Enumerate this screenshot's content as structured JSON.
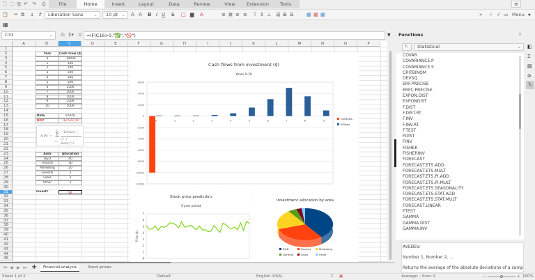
{
  "menu_tabs": [
    "File",
    "Home",
    "Insert",
    "Layout",
    "Data",
    "Review",
    "View",
    "Extension",
    "Tools"
  ],
  "active_tab": "Home",
  "toolbar": {
    "font_name": "Liberation Sans",
    "font_size": "10 pt",
    "menu_label": "Menu"
  },
  "formula_bar": {
    "cell_ref": "C31",
    "formula": "=IF(C16>0,\"✅\",\"🚫\")"
  },
  "columns": [
    "A",
    "B",
    "C",
    "D",
    "E",
    "F",
    "G",
    "H",
    "I",
    "J",
    "K",
    "L",
    "M",
    "N",
    "O",
    "P"
  ],
  "selected_column": "C",
  "selected_row": 31,
  "row_count": 45,
  "cells": [
    {
      "c": 1,
      "r": 2,
      "t": "Year",
      "b": true
    },
    {
      "c": 2,
      "r": 2,
      "t": "Cash Flow ($)",
      "b": true
    },
    {
      "c": 1,
      "r": 3,
      "t": "0"
    },
    {
      "c": 2,
      "r": 3,
      "t": "-10000"
    },
    {
      "c": 1,
      "r": 4,
      "t": "1"
    },
    {
      "c": 2,
      "r": 4,
      "t": "100"
    },
    {
      "c": 1,
      "r": 5,
      "t": "2"
    },
    {
      "c": 2,
      "r": 5,
      "t": "100"
    },
    {
      "c": 1,
      "r": 6,
      "t": "3"
    },
    {
      "c": 2,
      "r": 6,
      "t": "100"
    },
    {
      "c": 1,
      "r": 7,
      "t": "4"
    },
    {
      "c": 2,
      "r": 7,
      "t": "200"
    },
    {
      "c": 1,
      "r": 8,
      "t": "5"
    },
    {
      "c": 2,
      "r": 8,
      "t": "500"
    },
    {
      "c": 1,
      "r": 9,
      "t": "6"
    },
    {
      "c": 2,
      "r": 9,
      "t": "1500"
    },
    {
      "c": 1,
      "r": 10,
      "t": "7"
    },
    {
      "c": 2,
      "r": 10,
      "t": "3000"
    },
    {
      "c": 1,
      "r": 11,
      "t": "8"
    },
    {
      "c": 2,
      "r": 11,
      "t": "5000"
    },
    {
      "c": 1,
      "r": 12,
      "t": "9"
    },
    {
      "c": 2,
      "r": 12,
      "t": "3500"
    },
    {
      "c": 1,
      "r": 13,
      "t": "10"
    },
    {
      "c": 2,
      "r": 13,
      "t": "1000"
    },
    {
      "c": 1,
      "r": 15,
      "t": "Rate",
      "b": true,
      "l": true
    },
    {
      "c": 2,
      "r": 15,
      "t": "8.00%"
    },
    {
      "c": 1,
      "r": 16,
      "t": "NPV",
      "b": true,
      "l": true,
      "red": true
    },
    {
      "c": 2,
      "r": 16,
      "t": "-$1,522.09",
      "red": true
    },
    {
      "c": 1,
      "r": 23,
      "t": "Area",
      "b": true
    },
    {
      "c": 2,
      "r": 23,
      "t": "Allocation",
      "b": true
    },
    {
      "c": 1,
      "r": 24,
      "t": "R&D"
    },
    {
      "c": 2,
      "r": 24,
      "t": "40"
    },
    {
      "c": 1,
      "r": 25,
      "t": "Finance"
    },
    {
      "c": 2,
      "r": 25,
      "t": "30"
    },
    {
      "c": 1,
      "r": 26,
      "t": "Marketing"
    },
    {
      "c": 2,
      "r": 26,
      "t": "20"
    },
    {
      "c": 1,
      "r": 27,
      "t": "General"
    },
    {
      "c": 2,
      "r": 27,
      "t": "5"
    },
    {
      "c": 1,
      "r": 28,
      "t": "Sales"
    },
    {
      "c": 2,
      "r": 28,
      "t": "3"
    },
    {
      "c": 1,
      "r": 29,
      "t": "Other"
    },
    {
      "c": 2,
      "r": 29,
      "t": "2"
    },
    {
      "c": 1,
      "r": 31,
      "t": "Invest?",
      "b": true,
      "l": true
    },
    {
      "c": 2,
      "r": 31,
      "t": "🚫",
      "red": true
    }
  ],
  "npv_formula": {
    "lhs": "NPV =",
    "sum_top": "N",
    "sum_bottom": "i=1",
    "numerator": "Values_i",
    "denominator": "(1 + Rate)^i"
  },
  "chart_data": [
    {
      "type": "bar",
      "title": "Cash flows from investment ($)",
      "subtitle": "Years 0-10",
      "categories": [
        "0",
        "1",
        "2",
        "3",
        "4",
        "5",
        "6",
        "7",
        "8",
        "9"
      ],
      "series": [
        {
          "name": "Outflows",
          "color": "#ff420e",
          "values": [
            -10000,
            0,
            0,
            0,
            0,
            0,
            0,
            0,
            0,
            0
          ]
        },
        {
          "name": "Inflows",
          "color": "#2a6099",
          "values": [
            100,
            100,
            100,
            200,
            500,
            1500,
            3000,
            5000,
            3500,
            1000
          ]
        }
      ],
      "ylim": [
        -12000,
        6000
      ],
      "yticks": [
        6000,
        4000,
        2000,
        0,
        -2000,
        -4000,
        -6000,
        -8000,
        -10000,
        -12000
      ],
      "legend": "right"
    },
    {
      "type": "line",
      "title": "Stock price prediction",
      "subtitle": "3-year period",
      "ylabel": "Price ($)",
      "ylim": [
        0,
        7
      ],
      "yticks": [
        0,
        1,
        2,
        3,
        4,
        5,
        6,
        7
      ],
      "color": "#81d41a",
      "values": [
        5.1,
        4.6,
        4.6,
        5.1,
        4.4,
        5.0,
        4.9,
        5.1,
        5.6,
        5.5,
        5.3,
        4.8,
        5.8,
        4.9,
        5.0,
        5.2,
        4.9,
        4.5,
        5.1,
        4.5,
        4.5,
        4.2,
        4.3,
        5.2,
        4.6,
        4.1,
        5.5,
        5.3,
        4.8,
        4.7,
        4.9,
        4.5,
        5.6,
        4.4,
        5.8,
        5.5
      ]
    },
    {
      "type": "pie",
      "title": "Investment allocation by area",
      "categories": [
        "R&D",
        "Finance",
        "Marketing",
        "General",
        "Sales",
        "Other"
      ],
      "values": [
        40,
        30,
        20,
        5,
        3,
        2
      ],
      "colors": [
        "#004586",
        "#ff420e",
        "#ffd320",
        "#579d1c",
        "#7e0021",
        "#83caff"
      ],
      "legend": "bottom"
    }
  ],
  "sidebar": {
    "title": "Functions",
    "category": "Statistical",
    "functions": [
      "COVAR",
      "COVARIANCE.P",
      "COVARIANCE.S",
      "CRITBINOM",
      "DEVSQ",
      "ERF.PRECISE",
      "ERFC.PRECISE",
      "EXPON.DIST",
      "EXPONDIST",
      "F.DIST",
      "F.DIST.RT",
      "F.INV",
      "F.INV.RT",
      "F.TEST",
      "FDIST",
      "FINV",
      "FISHER",
      "FISHERINV",
      "FORECAST",
      "FORECAST.ETS.ADD",
      "FORECAST.ETS.MULT",
      "FORECAST.ETS.PI.ADD",
      "FORECAST.ETS.PI.MULT",
      "FORECAST.ETS.SEASONALITY",
      "FORECAST.ETS.STAT.ADD",
      "FORECAST.ETS.STAT.MULT",
      "FORECAST.LINEAR",
      "FTEST",
      "GAMMA",
      "GAMMA.DIST",
      "GAMMA.INV"
    ],
    "desc_name": "AVEDEV:",
    "desc_args": "Number 1, Number 2, ...",
    "desc_text": "Returns the average of the absolute deviations of a sample"
  },
  "sheet_tabs": [
    "Financial analysis",
    "Stock prices"
  ],
  "active_sheet": "Financial analysis",
  "status": {
    "sheet": "Sheet 1 of 2",
    "style": "Default",
    "language": "English (USA)",
    "sum": "Average: ; Sum: 0",
    "zoom": "100%"
  }
}
